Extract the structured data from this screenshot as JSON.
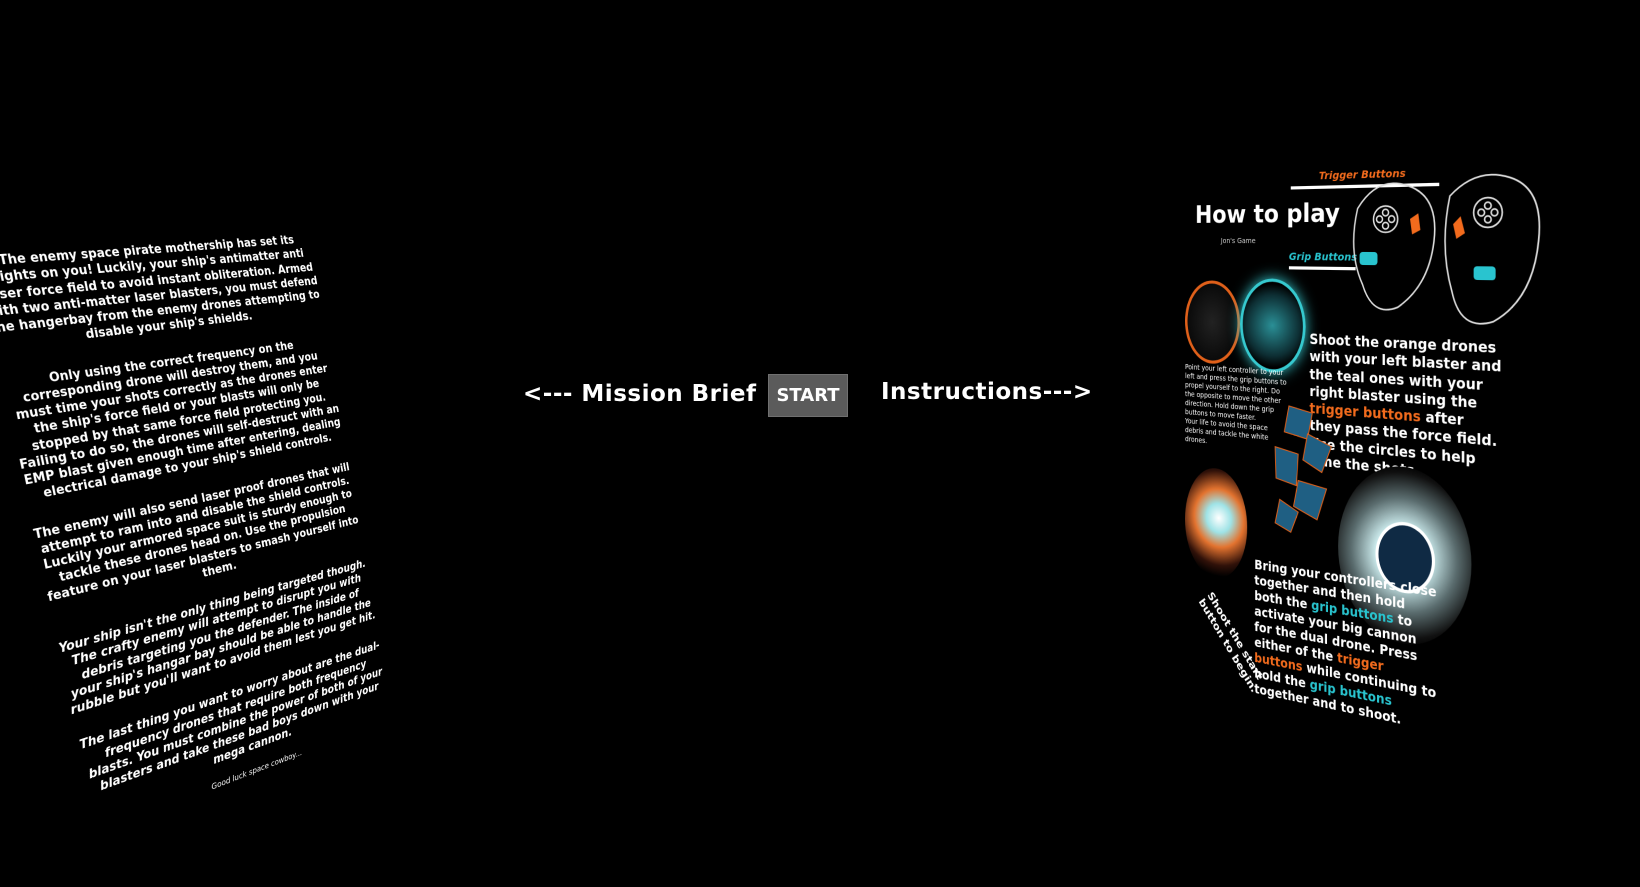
{
  "navigation": {
    "mission_brief_label": "<--- Mission Brief",
    "start_label": "START",
    "instructions_label": "Instructions--->"
  },
  "mission_brief": {
    "paragraph1": "The enemy space pirate mothership has set its sights on you! Luckily, your ship's antimatter anti laser force field to avoid instant obliteration. Armed with two anti-matter laser blasters, you must defend the hangerbay from the enemy drones attempting to disable your ship's shields.",
    "paragraph2": "Only using the correct frequency on the corresponding drone will destroy them, and you must time your shots correctly as the drones enter the ship's force field or your blasts will only be stopped by that same force field protecting you. Failing to do so, the drones will self-destruct with an EMP blast given enough time after entering, dealing electrical damage to your ship's shield controls.",
    "paragraph3": "The enemy will also send laser proof drones that will attempt to ram into and disable the shield controls. Luckily your armored space suit is sturdy enough to tackle these drones head on. Use the propulsion feature on your laser blasters to smash yourself into them.",
    "paragraph4": "Your ship isn't the only thing being targeted though. The crafty enemy will attempt to disrupt you with debris targeting you the defender. The inside of your ship's hangar bay should be able to handle the rubble but you'll want to avoid them lest you get hit.",
    "paragraph5": "The last thing you want to worry about are the dual-frequency drones that require both frequency blasts. You must combine the power of both of your blasters and take these bad boys down with your mega cannon.",
    "signoff": "Good luck space cowboy..."
  },
  "instructions": {
    "title": "How to play",
    "subtitle": "Jon's Game",
    "trigger_label": "Trigger Buttons",
    "grip_label": "Grip Buttons",
    "shoot_text_a": "Shoot the orange drones with your left blaster and the teal ones with your right blaster using the",
    "shoot_text_highlight": "trigger buttons",
    "shoot_text_b": "after they pass the force field. Use the circles to help time the shots.",
    "hold_text": "Point your left controller to your left and press the grip buttons to propel yourself to the right. Do the opposite to move the other direction. Hold down the grip buttons to move faster.",
    "avoid_text": "Your life to avoid the space debris and tackle the white drones.",
    "bring_text_a": "Bring your controllers close together and then hold both the",
    "bring_grip": "grip buttons",
    "bring_text_b": "to activate your big cannon for the dual drone. Press either of the",
    "bring_trigger": "trigger buttons",
    "bring_text_c": "while continuing to hold the",
    "bring_grip2": "grip buttons",
    "bring_text_d": "together and to shoot.",
    "start_hint": "Shoot the start button to begin."
  },
  "colors": {
    "background": "#000000",
    "start_button": "#5b5b5b",
    "orange_accent": "#f26b1d",
    "teal_accent": "#29c4cf"
  }
}
